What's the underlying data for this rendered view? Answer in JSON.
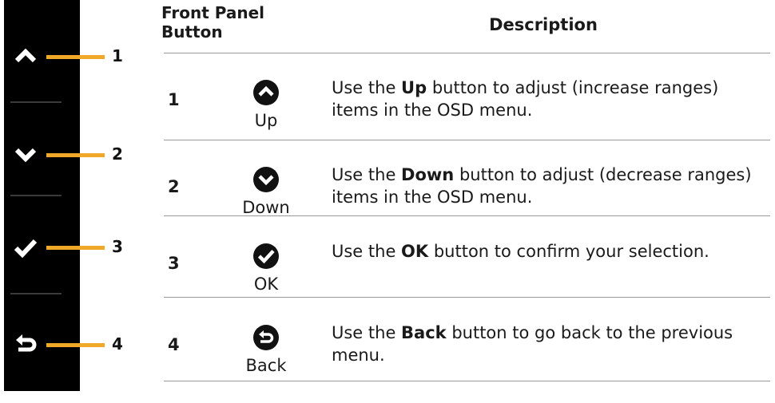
{
  "panel": {
    "buttons": [
      {
        "number": "1",
        "icon": "chevron-up-icon"
      },
      {
        "number": "2",
        "icon": "chevron-down-icon"
      },
      {
        "number": "3",
        "icon": "checkmark-icon"
      },
      {
        "number": "4",
        "icon": "back-arrow-icon"
      }
    ],
    "leader_color": "#f0a828"
  },
  "table": {
    "header_button_line1": "Front Panel",
    "header_button_line2": "Button",
    "header_description": "Description",
    "rows": [
      {
        "number": "1",
        "icon": "up-circle-icon",
        "name": "Up",
        "desc_before": "Use the ",
        "desc_bold": "Up",
        "desc_after": " button to adjust (increase ranges) items in the OSD menu."
      },
      {
        "number": "2",
        "icon": "down-circle-icon",
        "name": "Down",
        "desc_before": "Use the ",
        "desc_bold": "Down",
        "desc_after": " button to adjust (decrease ranges) items in the OSD menu."
      },
      {
        "number": "3",
        "icon": "ok-circle-icon",
        "name": "OK",
        "desc_before": "Use the ",
        "desc_bold": "OK",
        "desc_after": " button to confirm your selection."
      },
      {
        "number": "4",
        "icon": "back-circle-icon",
        "name": "Back",
        "desc_before": "Use the ",
        "desc_bold": "Back",
        "desc_after": " button to go back to the previous menu."
      }
    ]
  }
}
